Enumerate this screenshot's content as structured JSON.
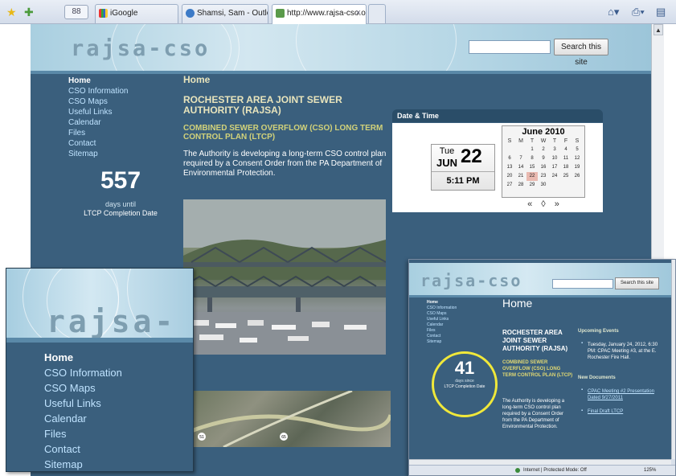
{
  "browser": {
    "quicktabs_label": "88",
    "tabs": [
      {
        "label": "iGoogle",
        "active": false
      },
      {
        "label": "Shamsi, Sam - Outlook Web ...",
        "active": false
      },
      {
        "label": "http://www.rajsa-cso.org/",
        "active": true
      }
    ],
    "close_glyph": "×",
    "icons": [
      "favorites-star-icon",
      "add-favorite-icon",
      "home-icon",
      "print-icon",
      "page-icon"
    ]
  },
  "site": {
    "logo": "rajsa-cso",
    "search_button": "Search this site",
    "nav": [
      "Home",
      "CSO Information",
      "CSO Maps",
      "Useful Links",
      "Calendar",
      "Files",
      "Contact",
      "Sitemap"
    ],
    "counter": {
      "number": "557",
      "sub": "days until",
      "label": "LTCP Completion Date"
    },
    "main": {
      "title": "Home",
      "heading1": "ROCHESTER AREA JOINT SEWER AUTHORITY (RAJSA)",
      "heading2": "COMBINED SEWER OVERFLOW (CSO) LONG TERM CONTROL PLAN (LTCP)",
      "paragraph": "The Authority is developing a long-term CSO control plan required by a Consent Order from the PA Department of Environmental Protection."
    },
    "datetime": {
      "title": "Date & Time",
      "dow": "Tue",
      "month": "JUN",
      "day": "22",
      "time": "5:11 PM",
      "calendar_title": "June 2010",
      "weekdays": [
        "S",
        "M",
        "T",
        "W",
        "T",
        "F",
        "S"
      ],
      "weeks": [
        [
          "",
          "",
          "1",
          "2",
          "3",
          "4",
          "5"
        ],
        [
          "6",
          "7",
          "8",
          "9",
          "10",
          "11",
          "12"
        ],
        [
          "13",
          "14",
          "15",
          "16",
          "17",
          "18",
          "19"
        ],
        [
          "20",
          "21",
          "22",
          "23",
          "24",
          "25",
          "26"
        ],
        [
          "27",
          "28",
          "29",
          "30",
          "",
          "",
          ""
        ]
      ],
      "today": "22",
      "nav": "« ◊ »"
    },
    "photo_labels": [
      "51",
      "65"
    ]
  },
  "zoom_window": {
    "logo": "rajsa-cso",
    "nav": [
      "Home",
      "CSO Information",
      "CSO Maps",
      "Useful Links",
      "Calendar",
      "Files",
      "Contact",
      "Sitemap"
    ]
  },
  "window2": {
    "logo": "rajsa-cso",
    "search_button": "Search this site",
    "nav": [
      "Home",
      "CSO Information",
      "CSO Maps",
      "Useful Links",
      "Calendar",
      "Files",
      "Contact",
      "Sitemap"
    ],
    "counter": {
      "number": "41",
      "sub": "days since",
      "label": "LTCP Completion Date"
    },
    "main_title": "Home",
    "heading1": "ROCHESTER AREA JOINT SEWER AUTHORITY (RAJSA)",
    "heading2": "COMBINED SEWER OVERFLOW (CSO) LONG TERM CONTROL PLAN (LTCP)",
    "paragraph": "The Authority is developing a long-term CSO control plan required by a Consent Order from the PA Department of Environmental Protection.",
    "events_title": "Upcoming Events",
    "event": "Tuesday, January 24, 2012, 6:30 PM: CPAC Meeting #3, at the E. Rochester Fire Hall.",
    "docs_title": "New Documents",
    "doc1": "CPAC Meeting #2 Presentation Dated 9/27/2011",
    "doc2": "Final Draft LTCP",
    "status_zone": "Internet | Protected Mode: Off",
    "status_zoom": "125%"
  },
  "colors": {
    "page_bg": "#3a5f7d",
    "header_light": "#d3e7f0",
    "nav_link": "#bfe3ff",
    "heading_cream": "#e8e4bc",
    "heading_olive": "#d2d27a",
    "highlight_circle": "#f0e83a"
  }
}
